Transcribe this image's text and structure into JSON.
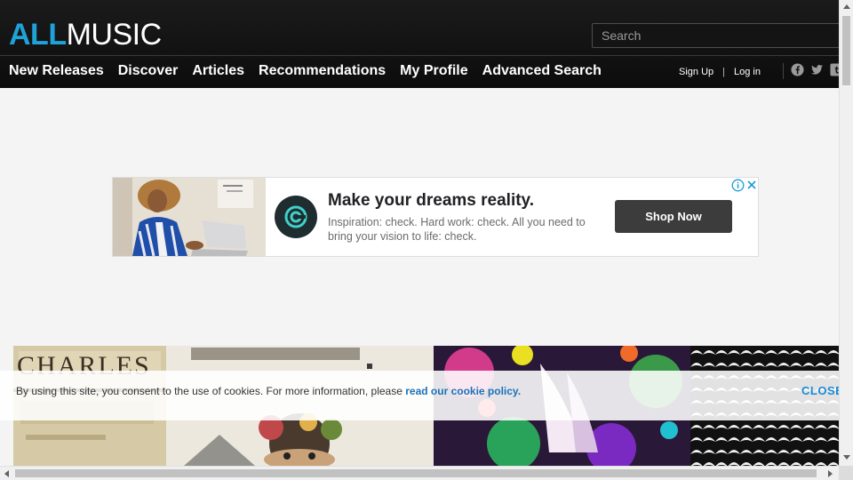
{
  "header": {
    "logo_all": "ALL",
    "logo_music": "MUSIC",
    "search_placeholder": "Search",
    "nav": [
      "New Releases",
      "Discover",
      "Articles",
      "Recommendations",
      "My Profile",
      "Advanced Search"
    ],
    "sign_up": "Sign Up",
    "separator": "|",
    "log_in": "Log in",
    "social_icons": [
      "facebook-icon",
      "twitter-icon",
      "tumblr-icon"
    ]
  },
  "ad": {
    "title": "Make your dreams reality.",
    "body": "Inspiration: check. Hard work: check. All you need to bring your vision to life: check.",
    "cta": "Shop Now",
    "icons": [
      "ad-info-icon",
      "ad-close-icon"
    ]
  },
  "album_strip": {
    "tile1_text": "CHARLES"
  },
  "cookie": {
    "text": "By using this site, you consent to the use of cookies. For more information, please ",
    "link": "read our cookie policy.",
    "close": "CLOSE"
  },
  "colors": {
    "brand_blue": "#1fa2d9",
    "header_bg": "#111111",
    "link_blue": "#1a72b8",
    "close_blue": "#1a8ad8"
  }
}
